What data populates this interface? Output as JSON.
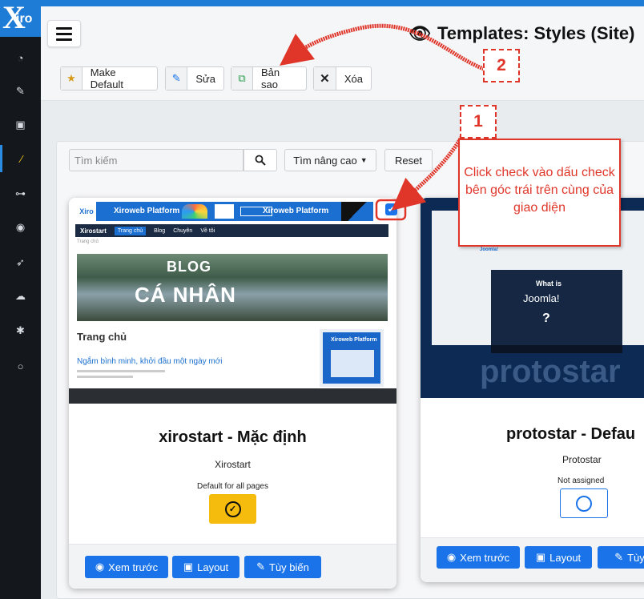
{
  "sidebar": {
    "logo_x": "X",
    "logo_rest": "iro",
    "items": [
      {
        "name": "dashboard-icon",
        "glyph": "◔"
      },
      {
        "name": "edit-icon",
        "glyph": "✎"
      },
      {
        "name": "image-icon",
        "glyph": "▣"
      },
      {
        "name": "magic-wand-icon",
        "glyph": "⁄"
      },
      {
        "name": "sitemap-icon",
        "glyph": "⊶"
      },
      {
        "name": "user-icon",
        "glyph": "◉"
      },
      {
        "name": "rocket-icon",
        "glyph": "➶"
      },
      {
        "name": "cloud-download-icon",
        "glyph": "☁"
      },
      {
        "name": "gear-icon",
        "glyph": "✱"
      },
      {
        "name": "circle-icon",
        "glyph": "○"
      }
    ]
  },
  "header": {
    "title": "Templates: Styles (Site)"
  },
  "toolbar": {
    "make_default": "Make Default",
    "edit": "Sửa",
    "copy": "Bản sao",
    "delete": "Xóa"
  },
  "filters": {
    "search_placeholder": "Tìm kiếm",
    "advanced": "Tìm nâng cao",
    "reset": "Reset"
  },
  "cards": [
    {
      "title": "xirostart - Mặc định",
      "template": "Xirostart",
      "status": "Default for all pages",
      "thumbnail": {
        "banner": "Xiroweb Platform",
        "nav_brand": "Xirostart",
        "nav_items": [
          "Trang chủ",
          "Blog",
          "Chuyên",
          "Về tôi"
        ],
        "breadcrumb": "Trang chủ",
        "hero_line1": "BLOG",
        "hero_line2": "CÁ NHÂN",
        "heading": "Trang chủ",
        "article": "Ngắm bình minh, khởi đầu một ngày mới"
      },
      "buttons": {
        "preview": "Xem trước",
        "layout": "Layout",
        "customize": "Tùy biến"
      },
      "selected": true
    },
    {
      "title": "protostar - Defau",
      "template": "Protostar",
      "status": "Not assigned",
      "thumbnail": {
        "brand": "protostar",
        "video_title": "What is",
        "video_brand": "Joomla!"
      },
      "buttons": {
        "preview": "Xem trước",
        "layout": "Layout",
        "customize": "Tùy"
      },
      "selected": false
    }
  ],
  "annotations": {
    "callout_line1": "Click check vào dấu check",
    "callout_line2": "bên góc trái trên cùng của giao diện",
    "step1": "1",
    "step2": "2",
    "color": "#e0362a"
  },
  "colors": {
    "primary": "#1a73e8",
    "sidebar_bg": "#14181d",
    "default_star": "#f5bb0d"
  }
}
